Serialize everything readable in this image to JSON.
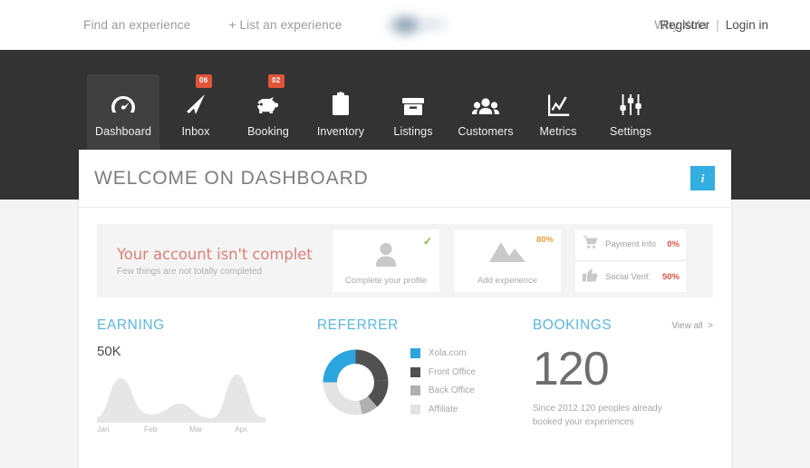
{
  "topbar": {
    "links": [
      {
        "label": "Find an experience",
        "name": "find-an-experience"
      },
      {
        "label": "+ List an experience",
        "name": "list-an-experience"
      }
    ],
    "why_xola": "Why Xola",
    "register": "Registrer",
    "separator": "|",
    "login": "Login in",
    "logo_alt": "xola-logo"
  },
  "appnav": {
    "items": [
      {
        "label": "Dashboard",
        "icon": "dashboard-gauge-icon",
        "badge": null,
        "active": true
      },
      {
        "label": "Inbox",
        "icon": "paper-plane-icon",
        "badge": "06",
        "active": false
      },
      {
        "label": "Booking",
        "icon": "piggy-bank-icon",
        "badge": "02",
        "active": false
      },
      {
        "label": "Inventory",
        "icon": "clipboard-icon",
        "badge": null,
        "active": false
      },
      {
        "label": "Listings",
        "icon": "box-icon",
        "badge": null,
        "active": false
      },
      {
        "label": "Customers",
        "icon": "people-icon",
        "badge": null,
        "active": false
      },
      {
        "label": "Metrics",
        "icon": "line-chart-icon",
        "badge": null,
        "active": false
      },
      {
        "label": "Settings",
        "icon": "sliders-icon",
        "badge": null,
        "active": false
      }
    ]
  },
  "panel": {
    "title": "WELCOME ON DASHBOARD",
    "info_button": "i",
    "info_icon": "info-icon"
  },
  "account": {
    "heading": "Your account isn't complet",
    "subheading": "Few things are not totally completed",
    "cards": [
      {
        "caption": "Complete your profile",
        "flag": "✓",
        "flag_type": "check",
        "icon": "user-avatar-icon"
      },
      {
        "caption": "Add experience",
        "flag": "80%",
        "flag_type": "percent",
        "icon": "mountain-icon"
      }
    ],
    "rows": [
      {
        "label": "Payment Info",
        "value": "0%",
        "icon": "shopping-cart-icon"
      },
      {
        "label": "Social Verif.",
        "value": "50%",
        "icon": "thumbs-up-icon"
      }
    ]
  },
  "widgets": {
    "earning": {
      "title": "EARNING",
      "value": "50K"
    },
    "referrer": {
      "title": "REFERRER"
    },
    "bookings": {
      "title": "BOOKINGS",
      "view_all": "View all",
      "view_all_icon": "chevron-right-icon",
      "count": "120",
      "description": "Since 2012 120 peoples already booked your experiences"
    }
  },
  "colors": {
    "nav_bg": "#333333",
    "nav_active": "#404040",
    "accent_blue": "#33aee0",
    "title_blue": "#5bb7e0",
    "badge_red": "#e0543a",
    "warn_red": "#e0524a",
    "ok_green": "#77bb41",
    "amber": "#e8a33d",
    "panel_bg": "#ffffff",
    "page_bg": "#f4f4f4"
  },
  "chart_data": [
    {
      "type": "area",
      "title": "EARNING",
      "categories": [
        "Jan",
        "Feb",
        "Mar",
        "Apr."
      ],
      "x": [
        "Jan",
        "Feb",
        "Mar",
        "Apr."
      ],
      "values": [
        8,
        46,
        12,
        20,
        6,
        50
      ],
      "ylabel": "50K",
      "ylim": [
        0,
        50
      ],
      "grid": false,
      "legend": "none",
      "series": [
        {
          "name": "Earning",
          "values": [
            8,
            46,
            12,
            20,
            6,
            50
          ]
        }
      ],
      "fill_color": "#e6e6e6"
    },
    {
      "type": "pie",
      "title": "REFERRER",
      "donut": true,
      "legend": "right",
      "labels": [
        "Xola.com",
        "Front Office",
        "Back Office",
        "Affiliate"
      ],
      "values": [
        25,
        26,
        15,
        34
      ],
      "colors": [
        "#2ca4dd",
        "#515151",
        "#b0b0b0",
        "#e3e3e3"
      ]
    }
  ]
}
